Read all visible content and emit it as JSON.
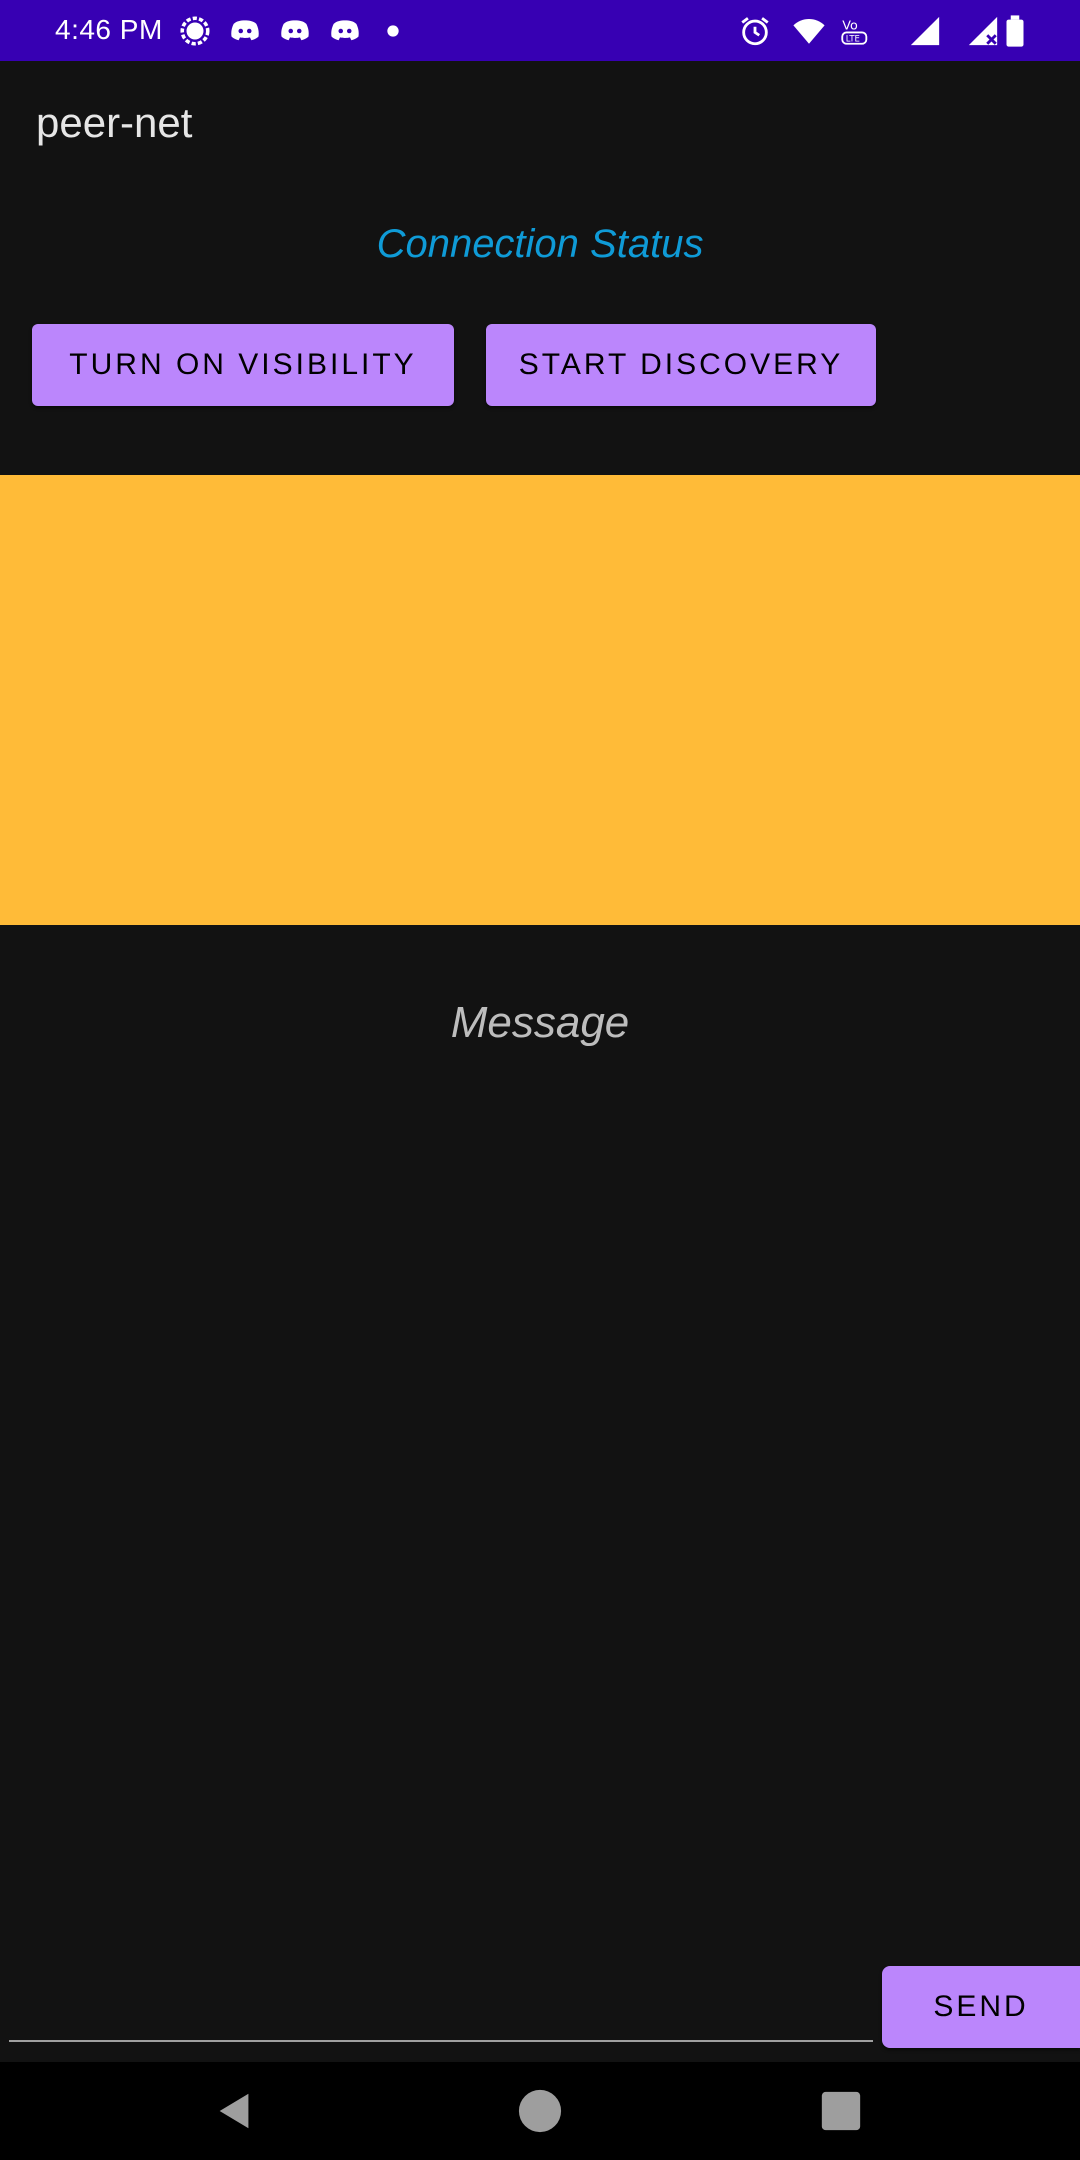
{
  "status_bar": {
    "time": "4:46 PM",
    "background": "#3700b3",
    "icons": [
      "signal-app-icon",
      "discord-icon",
      "discord-icon",
      "discord-icon",
      "dot-icon",
      "alarm-icon",
      "wifi-icon",
      "volte-icon",
      "cell-signal-icon",
      "cell-signal-no-icon",
      "battery-icon"
    ]
  },
  "app": {
    "title": "peer-net"
  },
  "connection": {
    "status_label": "Connection Status",
    "color": "#0f9bd7"
  },
  "buttons": {
    "visibility_label": "TURN ON VISIBILITY",
    "discovery_label": "START DISCOVERY",
    "send_label": "SEND",
    "accent": "#bb86fc"
  },
  "panel": {
    "color": "#ffbb38"
  },
  "message": {
    "placeholder": "Message"
  },
  "nav_bar": {
    "items": [
      "back-icon",
      "home-icon",
      "recents-icon"
    ]
  }
}
